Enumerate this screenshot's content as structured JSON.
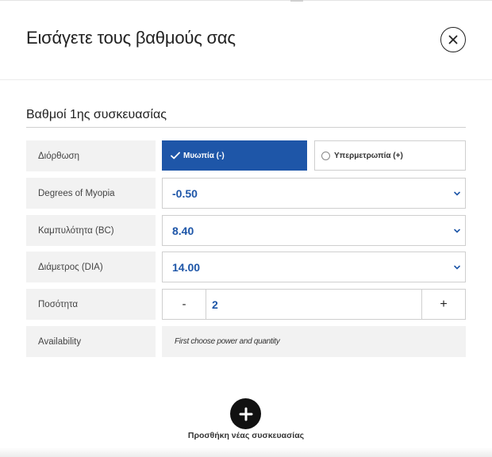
{
  "modal": {
    "title": "Εισάγετε τους βαθμούς σας",
    "close_icon": "close-icon"
  },
  "section": {
    "title": "Βαθμοί 1ης συσκευασίας"
  },
  "rows": {
    "correction": {
      "label": "Διόρθωση",
      "options": [
        {
          "label": "Μυωπία (-)",
          "selected": true,
          "icon": "check-icon"
        },
        {
          "label": "Υπερμετρωπία (+)",
          "selected": false,
          "icon": "radio-icon"
        }
      ]
    },
    "myopia": {
      "label": "Degrees of Myopia",
      "value": "-0.50",
      "icon": "chevron-down-icon"
    },
    "curvature": {
      "label": "Καμπυλότητα (BC)",
      "value": "8.40",
      "icon": "chevron-down-icon"
    },
    "diameter": {
      "label": "Διάμετρος (DIA)",
      "value": "14.00",
      "icon": "chevron-down-icon"
    },
    "quantity": {
      "label": "Ποσότητα",
      "minus": "-",
      "value": "2",
      "plus": "+"
    },
    "availability": {
      "label": "Availability",
      "value": "First choose power and quantity"
    }
  },
  "add_package": {
    "label": "Προσθήκη νέας συσκευασίας",
    "icon": "plus-icon"
  },
  "colors": {
    "accent": "#1e56a8",
    "label_bg": "#f2f2f2",
    "border": "#cfcfcf"
  }
}
